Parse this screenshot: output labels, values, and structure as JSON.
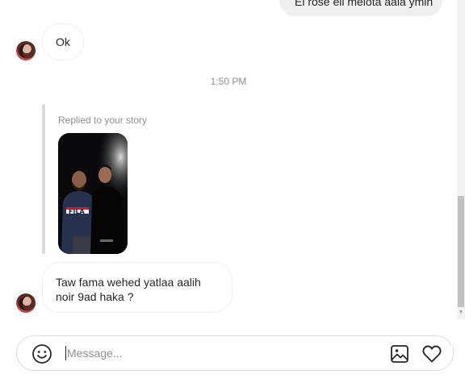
{
  "thread": {
    "messages": [
      {
        "direction": "outgoing",
        "text": "El rose eli melota aala ymin"
      },
      {
        "direction": "incoming",
        "text": "Ok"
      },
      {
        "direction": "incoming",
        "text": "Taw fama wehed yatlaa aalih noir 9ad haka ?"
      }
    ],
    "timestamp": "1:50 PM",
    "story_reply": {
      "label": "Replied to your story",
      "shirt_text": "FILA"
    }
  },
  "composer": {
    "placeholder": "Message...",
    "value": "",
    "icons": [
      "emoji-icon",
      "image-icon",
      "heart-icon"
    ]
  },
  "colors": {
    "outgoing_bubble": "#efefef",
    "border": "#dbdbdb",
    "muted_text": "#8e8e8e",
    "text": "#262626"
  }
}
